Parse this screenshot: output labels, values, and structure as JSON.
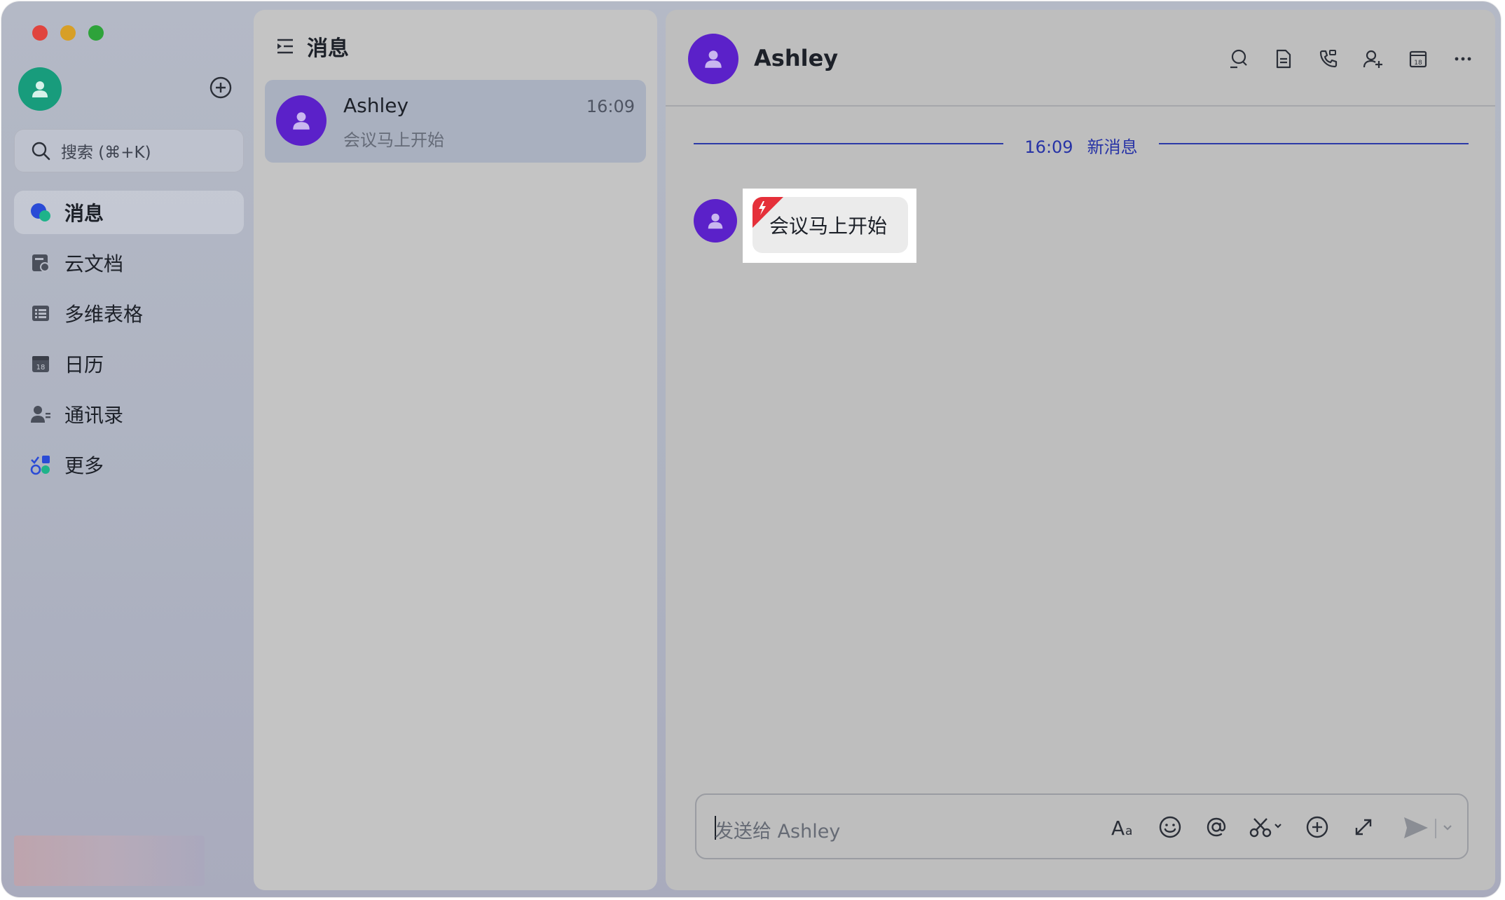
{
  "sidebar": {
    "search_placeholder": "搜索 (⌘+K)",
    "items": [
      {
        "label": "消息",
        "icon": "messages-icon",
        "active": true
      },
      {
        "label": "云文档",
        "icon": "cloud-docs-icon"
      },
      {
        "label": "多维表格",
        "icon": "base-table-icon"
      },
      {
        "label": "日历",
        "icon": "calendar-icon"
      },
      {
        "label": "通讯录",
        "icon": "contacts-icon"
      },
      {
        "label": "更多",
        "icon": "more-apps-icon"
      }
    ]
  },
  "conversations": {
    "title": "消息",
    "items": [
      {
        "name": "Ashley",
        "time": "16:09",
        "preview": "会议马上开始"
      }
    ]
  },
  "chat": {
    "title": "Ashley",
    "divider_time": "16:09",
    "divider_label": "新消息",
    "messages": [
      {
        "text": "会议马上开始",
        "urgent": true
      }
    ],
    "input_placeholder": "发送给 Ashley"
  },
  "colors": {
    "avatar_purple": "#5b21c9",
    "self_avatar_green": "#189c7c",
    "accent_blue": "#2733a6",
    "urgent_red": "#e5303a"
  }
}
